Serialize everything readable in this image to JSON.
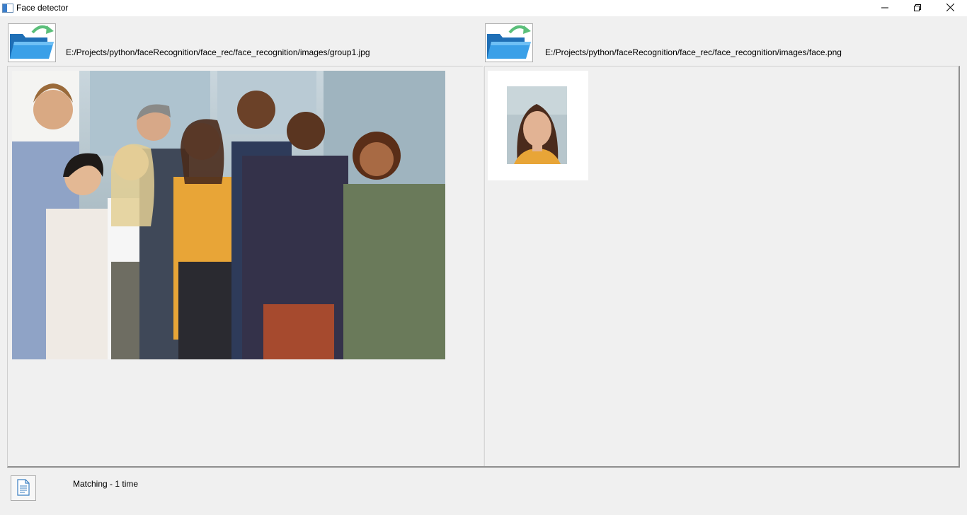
{
  "window": {
    "title": "Face detector",
    "icon": "app-window-icon",
    "controls": [
      "minimize-icon",
      "restore-icon",
      "close-icon"
    ]
  },
  "left_panel": {
    "open_button_icon": "open-folder-icon",
    "path": "E:/Projects/python/faceRecognition/face_rec/face_recognition/images/group1.jpg",
    "image": "group-photo"
  },
  "right_panel": {
    "open_button_icon": "open-folder-icon",
    "path": "E:/Projects/python/faceRecognition/face_rec/face_recognition/images/face.png",
    "image": "face-photo"
  },
  "status": {
    "button_icon": "document-icon",
    "text": "Matching - 1 time"
  },
  "colors": {
    "folder_blue": "#2f8fd8",
    "arrow_green": "#5bbf7a",
    "window_bg": "#f0f0f0"
  }
}
